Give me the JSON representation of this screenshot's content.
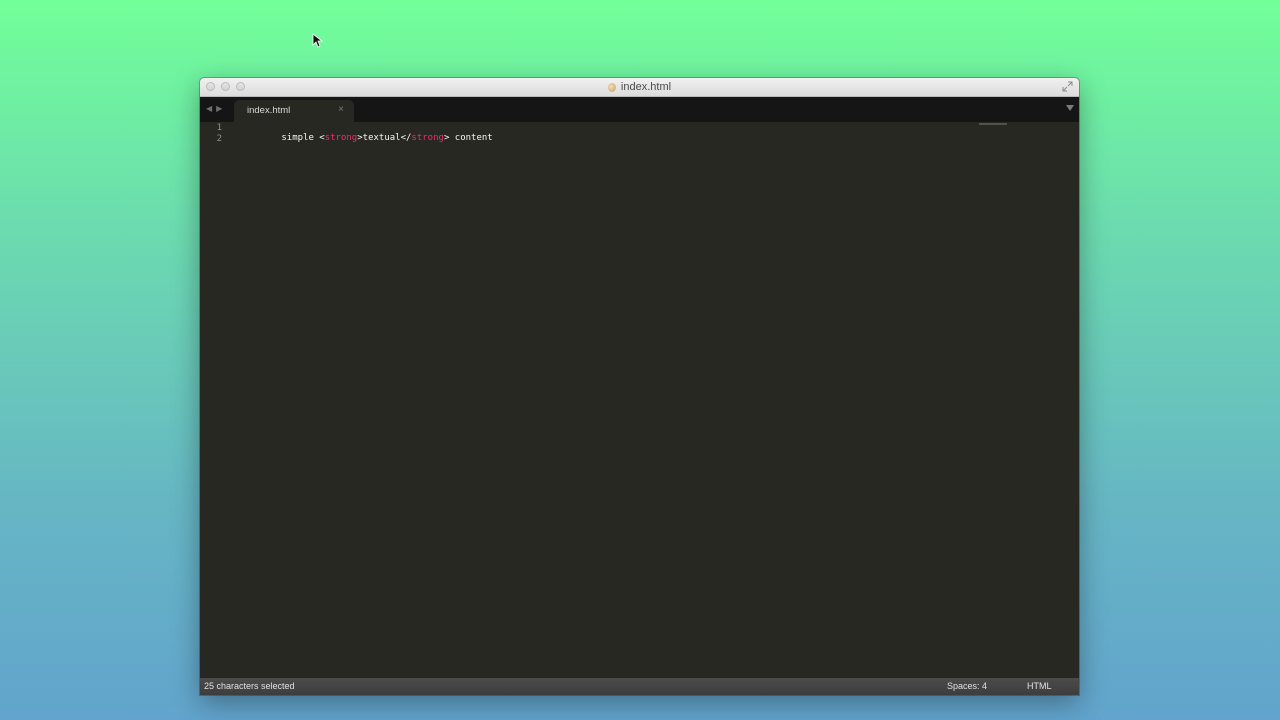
{
  "window": {
    "title": "index.html"
  },
  "tabs": [
    {
      "label": "index.html",
      "close": "×"
    }
  ],
  "editor": {
    "line_numbers": [
      "1",
      "2"
    ],
    "lines": [
      {
        "parts": [
          {
            "text": "simple <",
            "type": "text"
          },
          {
            "text": "strong",
            "type": "tag"
          },
          {
            "text": ">textual</",
            "type": "text"
          },
          {
            "text": "strong",
            "type": "tag"
          },
          {
            "text": "> content",
            "type": "text"
          }
        ]
      },
      {
        "parts": []
      }
    ]
  },
  "status": {
    "selection": "25 characters selected",
    "spaces": "Spaces: 4",
    "syntax": "HTML"
  },
  "colors": {
    "tag": "#f92672",
    "text": "#f8f8f2",
    "editor_bg": "#272822"
  },
  "icons": {
    "back": "back-arrow-icon",
    "forward": "forward-arrow-icon",
    "close": "close-icon",
    "tab_menu": "chevron-down-icon",
    "fullscreen": "fullscreen-icon",
    "file": "file-icon",
    "cursor": "mouse-cursor-icon"
  }
}
